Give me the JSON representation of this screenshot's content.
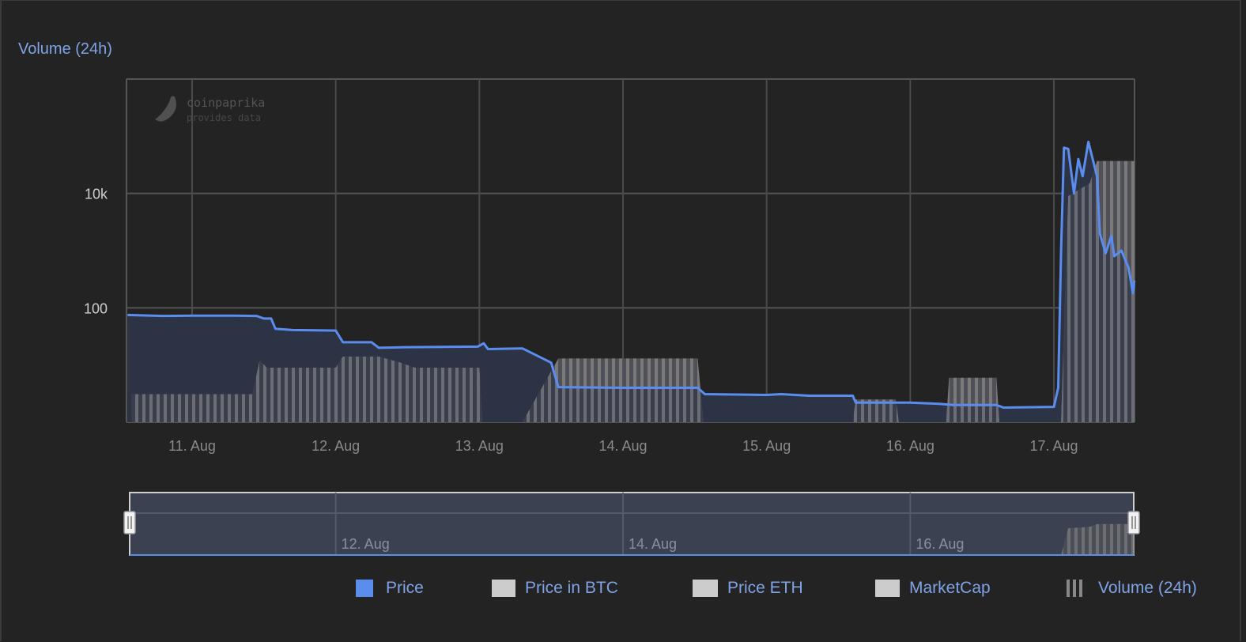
{
  "chart_data": {
    "type": "line",
    "title": "Volume (24h)",
    "xlabel": "",
    "ylabel": "",
    "y_scale": "log",
    "ylim": [
      1,
      1000000
    ],
    "xlim": [
      10.543,
      17.56
    ],
    "y_ticks": [
      {
        "value": 100,
        "label": "100"
      },
      {
        "value": 10000,
        "label": "10k"
      }
    ],
    "x_ticks": [
      {
        "value": 11,
        "label": "11. Aug"
      },
      {
        "value": 12,
        "label": "12. Aug"
      },
      {
        "value": 13,
        "label": "13. Aug"
      },
      {
        "value": 14,
        "label": "14. Aug"
      },
      {
        "value": 15,
        "label": "15. Aug"
      },
      {
        "value": 16,
        "label": "16. Aug"
      },
      {
        "value": 17,
        "label": "17. Aug"
      }
    ],
    "navigator_ticks": [
      {
        "value": 12,
        "label": "12. Aug"
      },
      {
        "value": 14,
        "label": "14. Aug"
      },
      {
        "value": 16,
        "label": "16. Aug"
      }
    ],
    "series": [
      {
        "name": "Price",
        "color": "#5b8def",
        "points": [
          [
            10.55,
            75
          ],
          [
            10.8,
            72
          ],
          [
            11.0,
            73
          ],
          [
            11.3,
            73
          ],
          [
            11.45,
            72
          ],
          [
            11.5,
            65
          ],
          [
            11.55,
            65
          ],
          [
            11.58,
            43
          ],
          [
            11.7,
            41
          ],
          [
            12.0,
            40
          ],
          [
            12.05,
            25
          ],
          [
            12.25,
            25
          ],
          [
            12.3,
            20
          ],
          [
            12.5,
            20.5
          ],
          [
            12.99,
            21
          ],
          [
            13.03,
            24
          ],
          [
            13.06,
            19
          ],
          [
            13.3,
            19.5
          ],
          [
            13.5,
            11
          ],
          [
            13.55,
            4.1
          ],
          [
            14.0,
            4
          ],
          [
            14.52,
            4
          ],
          [
            14.57,
            3.1
          ],
          [
            15.0,
            3
          ],
          [
            15.1,
            3.1
          ],
          [
            15.3,
            2.9
          ],
          [
            15.6,
            2.9
          ],
          [
            15.62,
            2.2
          ],
          [
            16.0,
            2.2
          ],
          [
            16.2,
            2.1
          ],
          [
            16.3,
            2.0
          ],
          [
            16.6,
            2.0
          ],
          [
            16.65,
            1.8
          ],
          [
            17.0,
            1.85
          ],
          [
            17.03,
            4
          ],
          [
            17.05,
            1000
          ],
          [
            17.07,
            63000
          ],
          [
            17.1,
            60000
          ],
          [
            17.14,
            10000
          ],
          [
            17.17,
            40000
          ],
          [
            17.2,
            20000
          ],
          [
            17.24,
            80000
          ],
          [
            17.3,
            20000
          ],
          [
            17.32,
            2000
          ],
          [
            17.36,
            900
          ],
          [
            17.4,
            1800
          ],
          [
            17.42,
            800
          ],
          [
            17.47,
            1000
          ],
          [
            17.52,
            500
          ],
          [
            17.55,
            180
          ],
          [
            17.56,
            300
          ]
        ]
      },
      {
        "name": "Price in BTC",
        "color": "#cccccc",
        "points": []
      },
      {
        "name": "Price ETH",
        "color": "#cccccc",
        "points": []
      },
      {
        "name": "MarketCap",
        "color": "#cccccc",
        "points": []
      },
      {
        "name": "Volume (24h)",
        "color": "#888888",
        "points": [
          [
            10.58,
            1
          ],
          [
            10.58,
            3.1
          ],
          [
            11.42,
            3.1
          ],
          [
            11.47,
            12
          ],
          [
            11.52,
            9
          ],
          [
            12.0,
            9
          ],
          [
            12.05,
            14
          ],
          [
            12.3,
            14
          ],
          [
            12.45,
            11
          ],
          [
            12.55,
            9
          ],
          [
            13.0,
            9
          ],
          [
            13.02,
            1
          ],
          [
            13.3,
            1
          ],
          [
            13.55,
            13
          ],
          [
            14.52,
            13
          ],
          [
            14.56,
            1
          ],
          [
            15.6,
            1
          ],
          [
            15.62,
            2.5
          ],
          [
            15.9,
            2.5
          ],
          [
            15.92,
            1
          ],
          [
            16.25,
            1
          ],
          [
            16.27,
            6
          ],
          [
            16.6,
            6
          ],
          [
            16.62,
            1
          ],
          [
            17.0,
            1
          ],
          [
            17.05,
            1
          ],
          [
            17.1,
            9000
          ],
          [
            17.25,
            15000
          ],
          [
            17.3,
            37000
          ],
          [
            17.56,
            37000
          ],
          [
            17.56,
            1
          ]
        ]
      }
    ],
    "legend_position": "bottom-right",
    "watermark": [
      "coinpaprika",
      "provides data"
    ]
  },
  "legend": [
    "Price",
    "Price in BTC",
    "Price ETH",
    "MarketCap",
    "Volume (24h)"
  ]
}
